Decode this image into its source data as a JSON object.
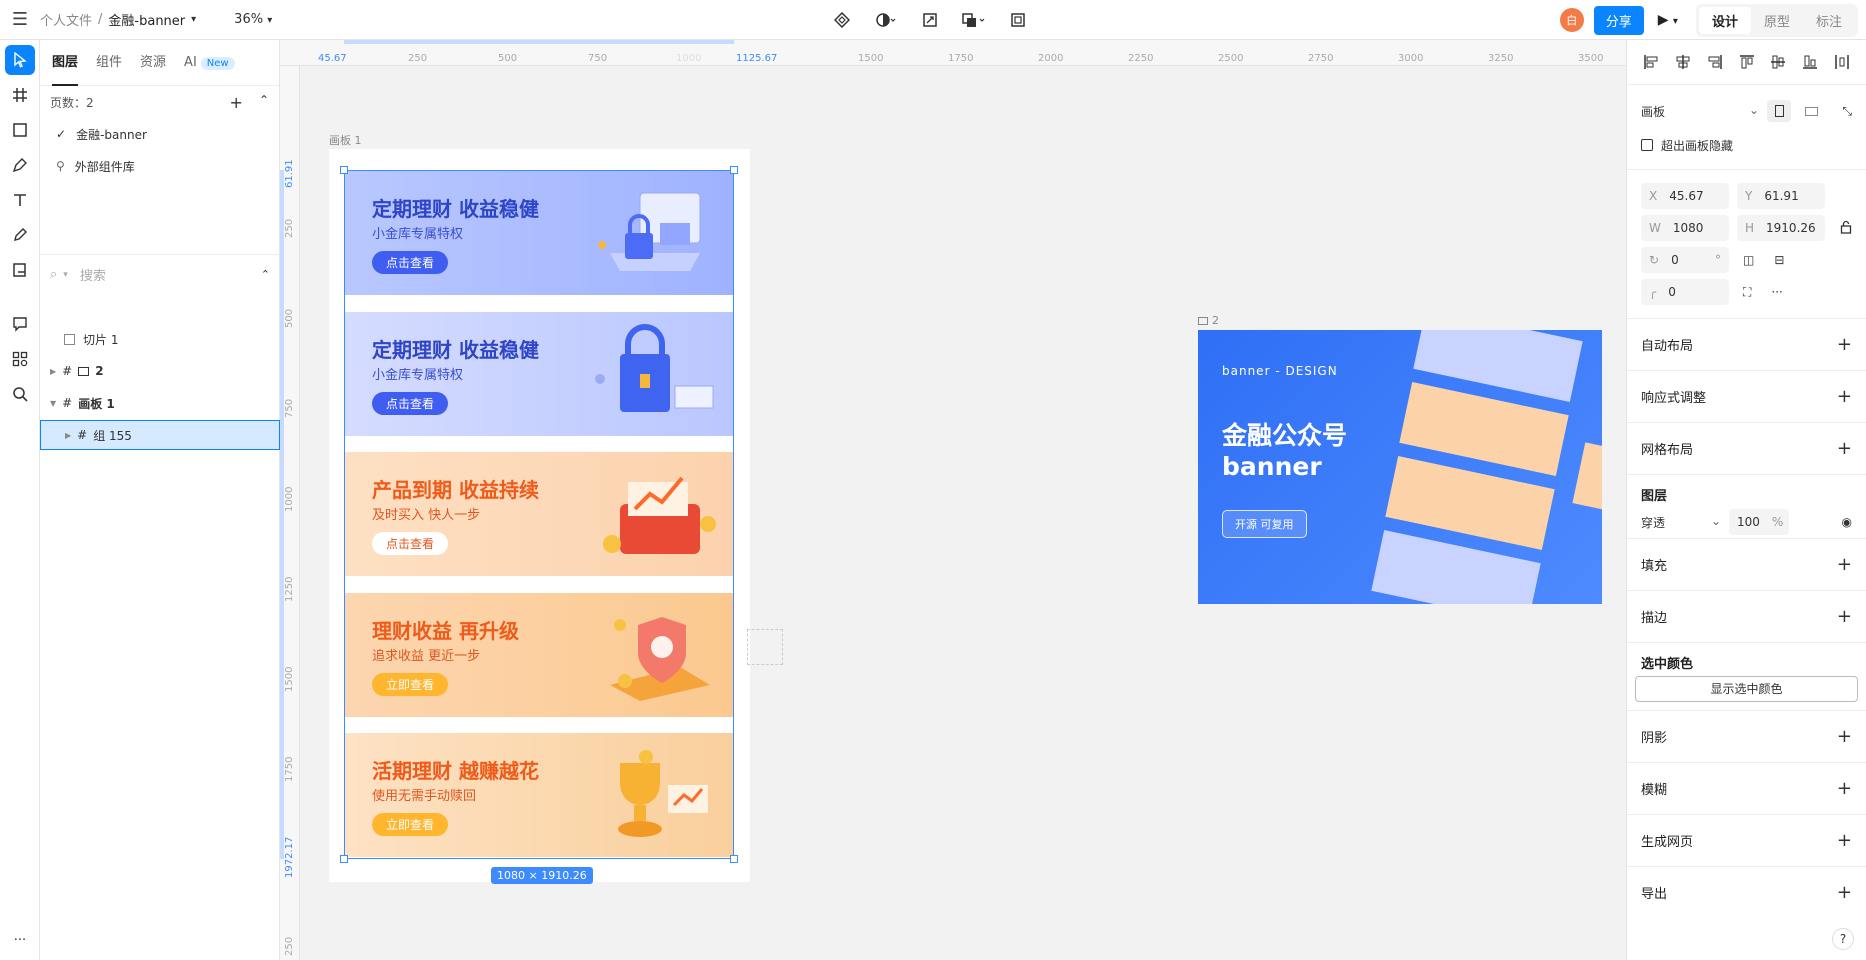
{
  "breadcrumb": {
    "root": "个人文件",
    "sep": "/",
    "file": "金融-banner"
  },
  "zoom": "36%",
  "share_label": "分享",
  "avatar_initial": "白",
  "modes": [
    "设计",
    "原型",
    "标注"
  ],
  "left_tabs": {
    "layers": "图层",
    "components": "组件",
    "assets": "资源",
    "ai": "AI",
    "new_badge": "New"
  },
  "pages": {
    "count_label": "页数：",
    "count": "2",
    "items": [
      "金融-banner",
      "外部组件库"
    ]
  },
  "search_placeholder": "搜索",
  "layers": {
    "slice": "切片 1",
    "group2": "2",
    "board1": "画板 1",
    "group155": "组 155"
  },
  "ruler": {
    "h_ticks": [
      "45.67",
      "250",
      "500",
      "750",
      "1000",
      "1125.67",
      "1500",
      "1750",
      "2000",
      "2250",
      "2500",
      "2750",
      "3000",
      "3250",
      "3500"
    ],
    "v_ticks": [
      "61.91",
      "250",
      "500",
      "750",
      "1000",
      "1250",
      "1500",
      "1750",
      "1972.17",
      "250"
    ]
  },
  "board1_label": "画板 1",
  "board2_label": "2",
  "size_tag": "1080 × 1910.26",
  "banners": [
    {
      "title": "定期理财 收益稳健",
      "sub": "小金库专属特权",
      "btn": "点击查看"
    },
    {
      "title": "定期理财  收益稳健",
      "sub": "小金库专属特权",
      "btn": "点击查看"
    },
    {
      "title": "产品到期 收益持续",
      "sub": "及时买入  快人一步",
      "btn": "点击查看"
    },
    {
      "title": "理财收益 再升级",
      "sub": "追求收益  更近一步",
      "btn": "立即查看"
    },
    {
      "title": "活期理财 越赚越花",
      "sub": "使用无需手动赎回",
      "btn": "立即查看"
    }
  ],
  "board2": {
    "design": "banner - DESIGN",
    "title1": "金融公众号",
    "title2": "banner",
    "btn": "开源 可复用"
  },
  "props": {
    "frame_type": "画板",
    "clip_label": "超出画板隐藏",
    "x_label": "X",
    "x": "45.67",
    "y_label": "Y",
    "y": "61.91",
    "w_label": "W",
    "w": "1080",
    "h_label": "H",
    "h": "1910.26",
    "rotation": "0",
    "rotation_unit": "°",
    "radius": "0",
    "auto_layout": "自动布局",
    "responsive": "响应式调整",
    "grid": "网格布局",
    "layer": "图层",
    "blend": "穿透",
    "opacity": "100",
    "opacity_unit": "%",
    "fill": "填充",
    "stroke": "描边",
    "sel_color": "选中颜色",
    "show_sel_color": "显示选中颜色",
    "shadow": "阴影",
    "blur": "模糊",
    "gen_web": "生成网页",
    "export": "导出"
  },
  "help": "?",
  "more": "···"
}
